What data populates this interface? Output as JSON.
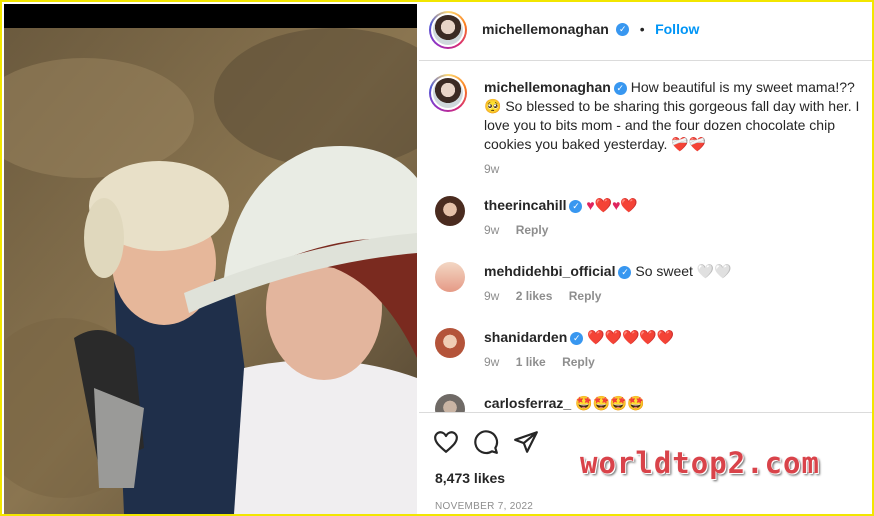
{
  "post": {
    "author": "michellemonaghan",
    "follow_label": "Follow",
    "separator": "•",
    "caption_text": "How beautiful is my sweet mama!?? 🥺 So blessed to be sharing this gorgeous fall day with her. I love you to bits mom - and the four dozen chocolate chip cookies you baked yesterday. ❤️‍🩹❤️‍🩹",
    "caption_time": "9w",
    "likes": "8,473 likes",
    "date": "NOVEMBER 7, 2022"
  },
  "comments": [
    {
      "user": "theerincahill",
      "text": "♥❤️♥❤️",
      "time": "9w",
      "likes": "",
      "reply": "Reply"
    },
    {
      "user": "mehdidehbi_official",
      "text": "So sweet 🤍🤍",
      "time": "9w",
      "likes": "2 likes",
      "reply": "Reply"
    },
    {
      "user": "shanidarden",
      "text": "❤️❤️❤️❤️❤️",
      "time": "9w",
      "likes": "1 like",
      "reply": "Reply"
    },
    {
      "user": "carlosferraz_",
      "text": "🤩🤩🤩🤩",
      "time": "",
      "likes": "",
      "reply": ""
    }
  ],
  "watermark": "worldtop2.com",
  "icons": [
    "heart-icon",
    "comment-icon",
    "share-icon",
    "verified-icon"
  ],
  "colors": {
    "accent": "#0095f6",
    "verified": "#3897f0",
    "frame": "#f2e600",
    "watermark": "#d9434a"
  }
}
